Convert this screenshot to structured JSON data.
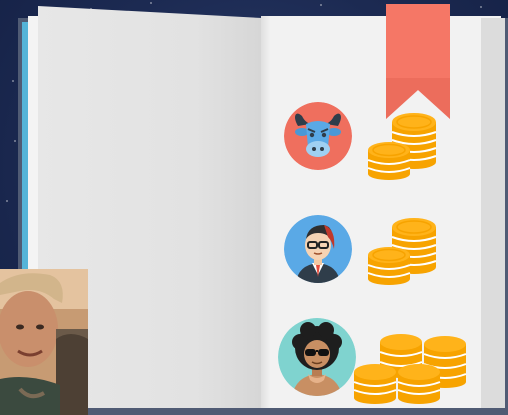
{
  "scene": {
    "description_icons": [
      "bull-avatar-icon",
      "man-with-glasses-avatar-icon",
      "man-with-sunglasses-avatar-icon",
      "coins-icon",
      "bookmark-icon"
    ]
  },
  "rows": [
    {
      "avatar": "bull-avatar-icon",
      "avatar_color": "#ef6f5e",
      "coins": "coins-icon"
    },
    {
      "avatar": "man-with-glasses-avatar-icon",
      "avatar_color": "#5aa9e6",
      "coins": "coins-icon"
    },
    {
      "avatar": "man-with-sunglasses-avatar-icon",
      "avatar_color": "#7fd3cf",
      "coins": "coins-icon"
    }
  ],
  "colors": {
    "background": "#1c2a52",
    "bookmark": "#f57766",
    "coin": "#f7a300",
    "coin_stripe": "#ffffff",
    "page": "#f2f2f2",
    "page_edge_blue": "#55b4d8"
  }
}
